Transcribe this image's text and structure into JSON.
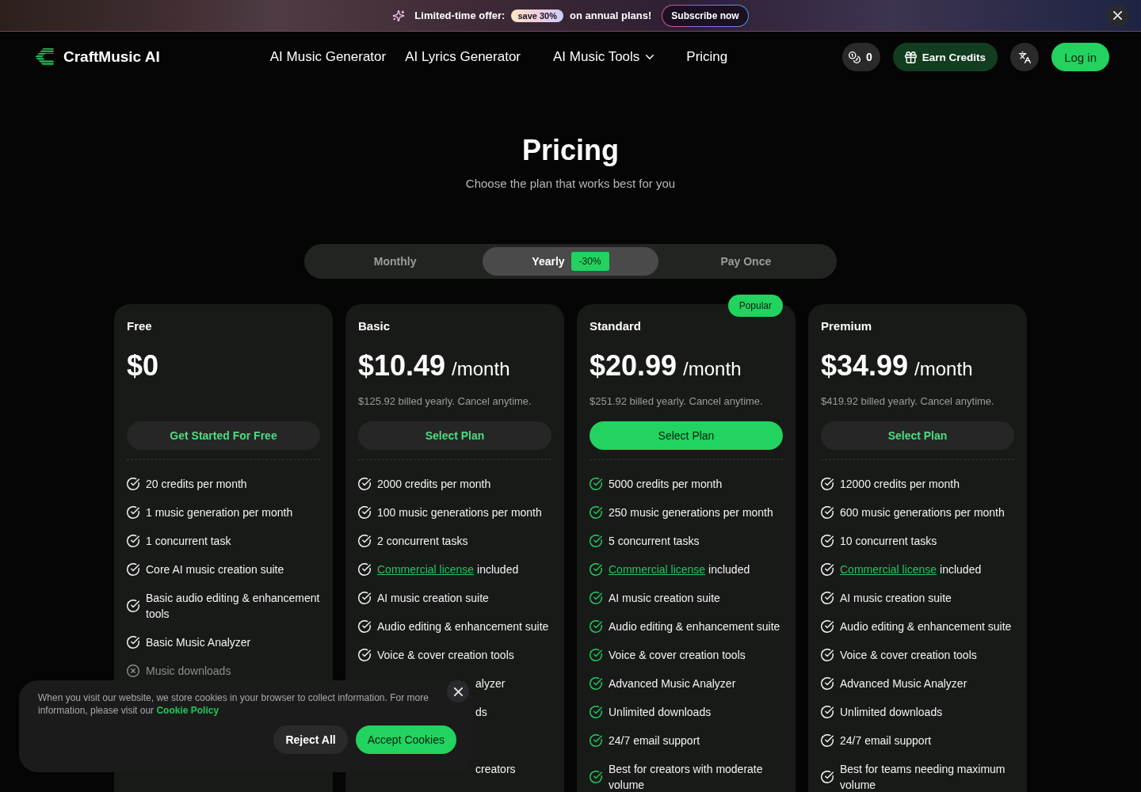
{
  "promo_banner": {
    "lead": "Limited-time offer:",
    "badge": "save 30%",
    "tail": "on annual plans!",
    "button": "Subscribe now"
  },
  "nav": {
    "brand": "CraftMusic AI",
    "links": [
      {
        "label": "AI Music Generator",
        "kind": "link"
      },
      {
        "label": "AI Lyrics Generator",
        "kind": "link"
      },
      {
        "label": "AI Music Tools",
        "kind": "dropdown"
      },
      {
        "label": "Pricing",
        "kind": "link"
      }
    ],
    "credits": "0",
    "earn_button": "Earn Credits",
    "login_button": "Log in"
  },
  "header": {
    "title": "Pricing",
    "subtitle": "Choose the plan that works best for you"
  },
  "billing_tabs": [
    {
      "label": "Monthly",
      "selected": false
    },
    {
      "label": "Yearly",
      "selected": true,
      "badge": "-30%"
    },
    {
      "label": "Pay Once",
      "selected": false
    }
  ],
  "plans": [
    {
      "name": "Free",
      "price": "$0",
      "featured": false,
      "button": "Get Started For Free",
      "features": [
        {
          "text": "20 credits per month",
          "included": true
        },
        {
          "text": "1 music generation per month",
          "included": true
        },
        {
          "text": "1 concurrent task",
          "included": true
        },
        {
          "text": "Core AI music creation suite",
          "included": true
        },
        {
          "text": "Basic audio editing & enhancement tools",
          "included": true
        },
        {
          "text": "Basic Music Analyzer",
          "included": true
        },
        {
          "text": "Music downloads",
          "included": false
        }
      ]
    },
    {
      "name": "Basic",
      "price": "$10.49",
      "period": "/month",
      "note": "$125.92 billed yearly. Cancel anytime.",
      "featured": false,
      "button": "Select Plan",
      "features": [
        {
          "text": "2000 credits per month",
          "included": true
        },
        {
          "text": "100 music generations per month",
          "included": true
        },
        {
          "text": "2 concurrent tasks",
          "included": true
        },
        {
          "link": "Commercial license",
          "text": "included",
          "included": true
        },
        {
          "text": "AI music creation suite",
          "included": true
        },
        {
          "text": "Audio editing & enhancement suite",
          "included": true
        },
        {
          "text": "Voice & cover creation tools",
          "included": true
        }
      ],
      "covered_features": [
        "alyzer",
        "ds",
        "creators"
      ]
    },
    {
      "name": "Standard",
      "badge": "Popular",
      "price": "$20.99",
      "period": "/month",
      "note": "$251.92 billed yearly. Cancel anytime.",
      "featured": true,
      "button": "Select Plan",
      "features": [
        {
          "text": "5000 credits per month",
          "included": true
        },
        {
          "text": "250 music generations per month",
          "included": true
        },
        {
          "text": "5 concurrent tasks",
          "included": true
        },
        {
          "link": "Commercial license",
          "text": "included",
          "included": true
        },
        {
          "text": "AI music creation suite",
          "included": true
        },
        {
          "text": "Audio editing & enhancement suite",
          "included": true
        },
        {
          "text": "Voice & cover creation tools",
          "included": true
        },
        {
          "text": "Advanced Music Analyzer",
          "included": true
        },
        {
          "text": "Unlimited downloads",
          "included": true
        },
        {
          "text": "24/7 email support",
          "included": true
        },
        {
          "text": "Best for creators with moderate volume",
          "included": true
        }
      ]
    },
    {
      "name": "Premium",
      "price": "$34.99",
      "period": "/month",
      "note": "$419.92 billed yearly. Cancel anytime.",
      "featured": false,
      "button": "Select Plan",
      "features": [
        {
          "text": "12000 credits per month",
          "included": true
        },
        {
          "text": "600 music generations per month",
          "included": true
        },
        {
          "text": "10 concurrent tasks",
          "included": true
        },
        {
          "link": "Commercial license",
          "text": "included",
          "included": true
        },
        {
          "text": "AI music creation suite",
          "included": true
        },
        {
          "text": "Audio editing & enhancement suite",
          "included": true
        },
        {
          "text": "Voice & cover creation tools",
          "included": true
        },
        {
          "text": "Advanced Music Analyzer",
          "included": true
        },
        {
          "text": "Unlimited downloads",
          "included": true
        },
        {
          "text": "24/7 email support",
          "included": true
        },
        {
          "text": "Best for teams needing maximum volume",
          "included": true
        }
      ]
    }
  ],
  "cookie_banner": {
    "text": "When you visit our website, we store cookies in your browser to collect information. For more information, please visit our",
    "link": "Cookie Policy",
    "buttons": [
      {
        "label": "Reject All",
        "kind": "secondary"
      },
      {
        "label": "Accept Cookies",
        "kind": "primary"
      }
    ]
  }
}
